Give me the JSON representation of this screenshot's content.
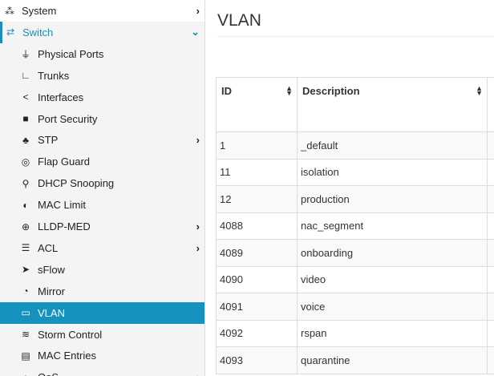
{
  "sidebar": {
    "items": [
      {
        "label": "System",
        "icon": "cubes-icon",
        "glyph": "⁂",
        "chevron": "›"
      },
      {
        "label": "Switch",
        "icon": "exchange-icon",
        "glyph": "⇄",
        "chevron": "⌄"
      },
      {
        "label": "Physical Ports",
        "icon": "plug-icon",
        "glyph": "⏚"
      },
      {
        "label": "Trunks",
        "icon": "trunk-icon",
        "glyph": "∟"
      },
      {
        "label": "Interfaces",
        "icon": "share-icon",
        "glyph": "<"
      },
      {
        "label": "Port Security",
        "icon": "lock-icon",
        "glyph": "■"
      },
      {
        "label": "STP",
        "icon": "tree-icon",
        "glyph": "♣",
        "chevron": "›"
      },
      {
        "label": "Flap Guard",
        "icon": "toggle-icon",
        "glyph": "◎"
      },
      {
        "label": "DHCP Snooping",
        "icon": "search-icon",
        "glyph": "⚲"
      },
      {
        "label": "MAC Limit",
        "icon": "adjust-icon",
        "glyph": "◐"
      },
      {
        "label": "LLDP-MED",
        "icon": "search-plus-icon",
        "glyph": "⊕",
        "chevron": "›"
      },
      {
        "label": "ACL",
        "icon": "list-icon",
        "glyph": "☰",
        "chevron": "›"
      },
      {
        "label": "sFlow",
        "icon": "paper-plane-icon",
        "glyph": "➤"
      },
      {
        "label": "Mirror",
        "icon": "pie-chart-icon",
        "glyph": "◔"
      },
      {
        "label": "VLAN",
        "icon": "laptop-icon",
        "glyph": "▭"
      },
      {
        "label": "Storm Control",
        "icon": "wind-icon",
        "glyph": "≋"
      },
      {
        "label": "MAC Entries",
        "icon": "clipboard-icon",
        "glyph": "▤"
      },
      {
        "label": "QoS",
        "icon": "qos-icon",
        "glyph": "▲",
        "chevron": "›"
      }
    ]
  },
  "page": {
    "title": "VLAN"
  },
  "table": {
    "headers": [
      "ID",
      "Description"
    ],
    "sort_glyph": "▲▼",
    "rows": [
      [
        "1",
        "_default"
      ],
      [
        "11",
        "isolation"
      ],
      [
        "12",
        "production"
      ],
      [
        "4088",
        "nac_segment"
      ],
      [
        "4089",
        "onboarding"
      ],
      [
        "4090",
        "video"
      ],
      [
        "4091",
        "voice"
      ],
      [
        "4092",
        "rspan"
      ],
      [
        "4093",
        "quarantine"
      ]
    ]
  },
  "colors": {
    "accent": "#1593be",
    "sidebar_bg": "#f4f4f4"
  }
}
